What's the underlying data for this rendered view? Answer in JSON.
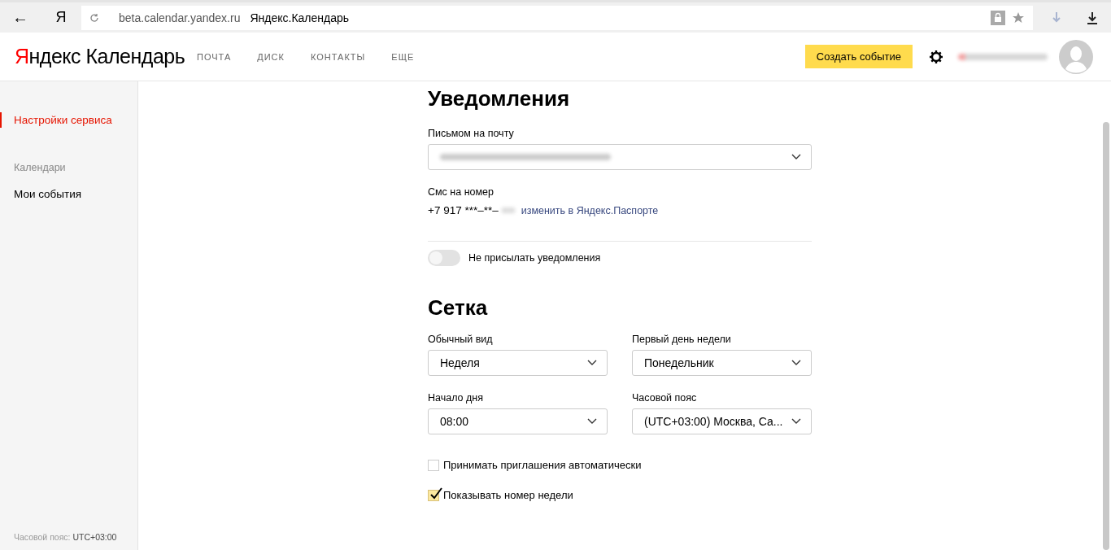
{
  "browser": {
    "back": "←",
    "yandex_button": "Я",
    "url": "beta.calendar.yandex.ru",
    "page_title": "Яндекс.Календарь"
  },
  "header": {
    "logo": "Яндекс Календарь",
    "nav": [
      {
        "label": "ПОЧТА"
      },
      {
        "label": "ДИСК"
      },
      {
        "label": "КОНТАКТЫ"
      },
      {
        "label": "ЕЩЕ"
      }
    ],
    "create_button": "Создать событие"
  },
  "sidebar": {
    "items": [
      {
        "label": "Настройки сервиса",
        "kind": "item",
        "selected": true
      },
      {
        "label": "Календари",
        "kind": "heading"
      },
      {
        "label": "Мои события",
        "kind": "item",
        "selected": false
      }
    ],
    "timezone_label": "Часовой пояс:",
    "timezone_value": "UTC+03:00"
  },
  "notifications": {
    "title": "Уведомления",
    "email_label": "Письмом на почту",
    "sms_label": "Смс на номер",
    "phone": "+7 917 ***–**–",
    "change_link": "изменить в Яндекс.Паспорте",
    "toggle": {
      "label": "Не присылать уведомления",
      "on": false
    }
  },
  "grid": {
    "title": "Сетка",
    "selects": [
      {
        "label": "Обычный вид",
        "value": "Неделя"
      },
      {
        "label": "Первый день недели",
        "value": "Понедельник"
      },
      {
        "label": "Начало дня",
        "value": "08:00"
      },
      {
        "label": "Часовой пояс",
        "value": "(UTC+03:00) Москва, Са..."
      }
    ],
    "checkboxes": [
      {
        "label": "Принимать приглашения автоматически",
        "checked": false
      },
      {
        "label": "Показывать номер недели",
        "checked": true
      }
    ]
  }
}
